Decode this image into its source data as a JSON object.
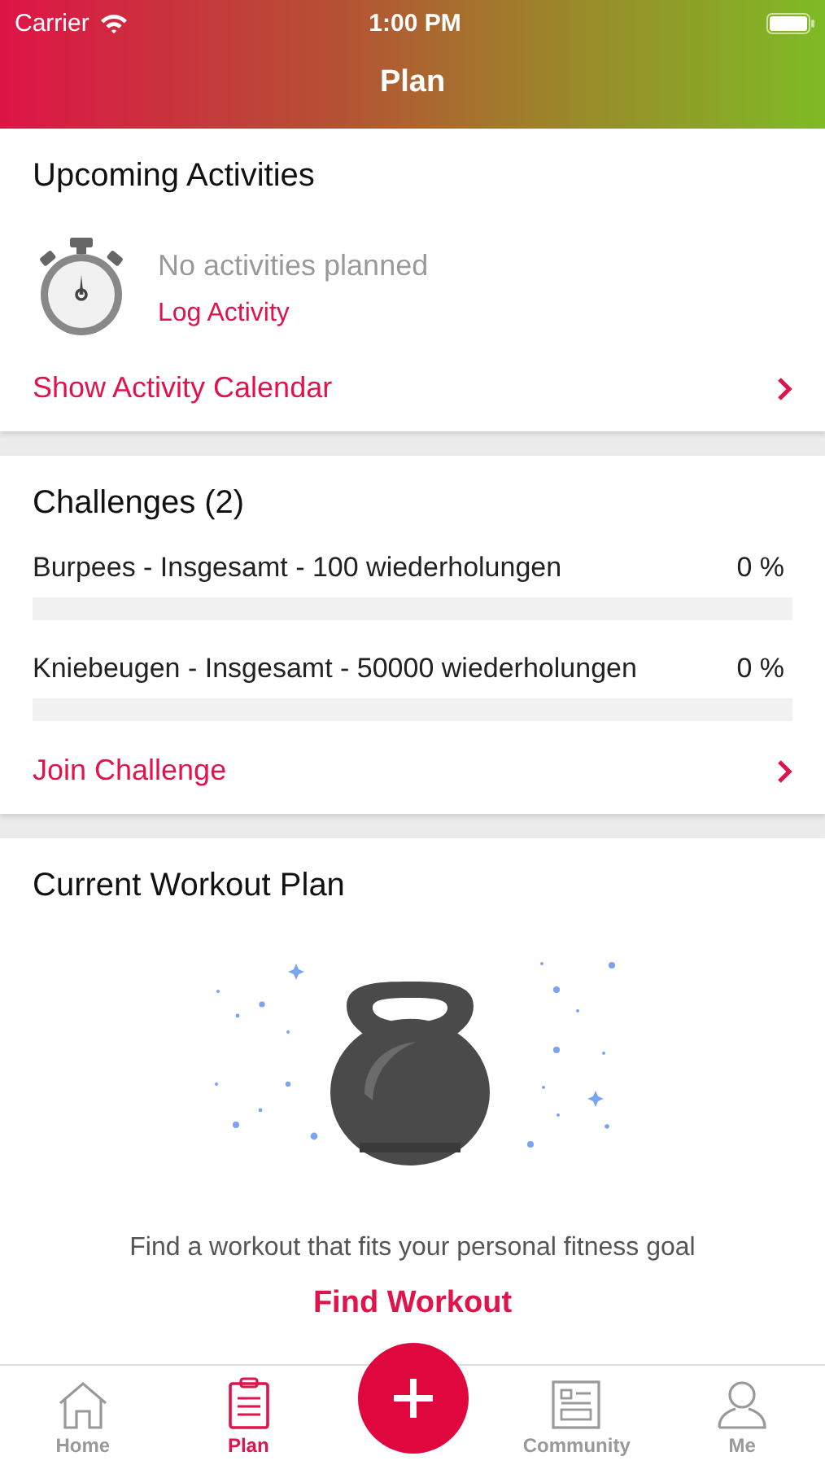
{
  "status_bar": {
    "carrier": "Carrier",
    "time": "1:00 PM"
  },
  "nav": {
    "title": "Plan"
  },
  "upcoming": {
    "title": "Upcoming Activities",
    "empty_text": "No activities planned",
    "log_link": "Log Activity",
    "calendar_link": "Show Activity Calendar"
  },
  "challenges": {
    "title": "Challenges (2)",
    "items": [
      {
        "name": "Burpees - Insgesamt - 100 wiederholungen",
        "percent": "0 %",
        "level": 0
      },
      {
        "name": "Kniebeugen - Insgesamt - 50000 wiederholungen",
        "percent": "0 %",
        "level": 0
      }
    ],
    "join_link": "Join Challenge"
  },
  "workout_plan": {
    "title": "Current Workout Plan",
    "message": "Find a workout that fits your personal fitness goal",
    "button": "Find Workout"
  },
  "tab_bar": {
    "tabs": [
      {
        "label": "Home",
        "kind": "home",
        "selected": false
      },
      {
        "label": "Plan",
        "kind": "plan",
        "selected": true
      },
      {
        "label": "Community",
        "kind": "community",
        "selected": false
      },
      {
        "label": "Me",
        "kind": "me",
        "selected": false
      }
    ]
  }
}
